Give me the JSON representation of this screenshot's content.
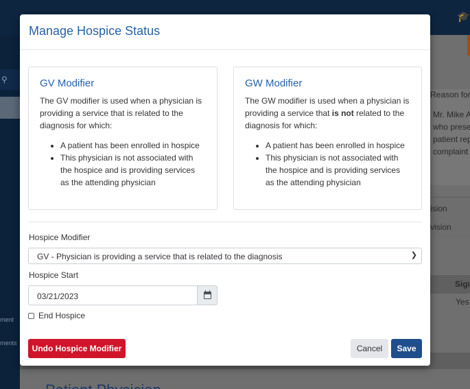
{
  "background": {
    "topbar_icon": "graduation-cap-icon",
    "right_texts": [
      "Reason for V",
      "Mr. Mike A",
      "who prese",
      "patient rep",
      "complaint"
    ],
    "table_texts": [
      "ision",
      "vision"
    ],
    "table_header": "Sign",
    "table_cell": "Yes",
    "sidebar_texts": [
      "ment",
      "ments"
    ],
    "bottom_heading": "Patient Physician"
  },
  "modal": {
    "title": "Manage Hospice Status",
    "gv_card": {
      "title": "GV Modifier",
      "description": "The GV modifier is used when a physician is providing a service that is related to the diagnosis for which:",
      "bullets": [
        "A patient has been enrolled in hospice",
        "This physician is not associated with the hospice and is providing services as the attending physician"
      ]
    },
    "gw_card": {
      "title": "GW Modifier",
      "description_before": "The GW modifier is used when a physician is providing a service that ",
      "description_bold": "is not",
      "description_after": " related to the diagnosis for which:",
      "bullets": [
        "A patient has been enrolled in hospice",
        "This physician is not associated with the hospice and is providing services as the attending physician"
      ]
    },
    "form": {
      "modifier_label": "Hospice Modifier",
      "modifier_value": "GV - Physician is providing a service that is related to the diagnosis",
      "start_label": "Hospice Start",
      "start_value": "03/21/2023",
      "end_label": "End Hospice",
      "end_checked": false
    },
    "buttons": {
      "undo": "Undo Hospice Modifier",
      "cancel": "Cancel",
      "save": "Save"
    }
  }
}
